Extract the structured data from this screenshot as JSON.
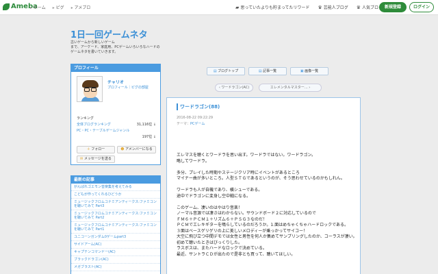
{
  "topbar": {
    "logo": "Ameba",
    "nav": [
      "ホーム",
      "ピグ",
      "アメブロ"
    ],
    "right_links": [
      {
        "icon": "bookmark-icon",
        "label": "思っていたよりも貯まってたリワード"
      },
      {
        "icon": "crown-icon",
        "label": "芸能人ブログ"
      },
      {
        "icon": "crown-icon",
        "label": "人気ブログ"
      }
    ],
    "new_register": "新規登録",
    "login": "ログイン"
  },
  "header": {
    "title": "1日一回ゲームネタ",
    "desc_lines": [
      "古いゲームから新しいゲーム",
      "まで、アーケード、家庭用、PCゲームいろいろなハードの",
      "ゲームネタを書いていきます。"
    ]
  },
  "profile": {
    "head": "プロフィール",
    "name": "チャリオ",
    "links": "プロフィール｜ピグの部屋",
    "ranking_label": "ランキング",
    "rank1_label": "全体ブログランキング",
    "rank1_value": "31,116位 ↓",
    "rank2_label": "PC・PC・テーブルゲームジャンル",
    "rank2_value": "197位 ↓",
    "follow": "フォロー",
    "ameba_friend": "アメンバーになる",
    "message": "メッセージを送る"
  },
  "recent": {
    "head": "最新の記事",
    "items": [
      "がんばれゴエモン音楽集を考えてみる",
      "こどもが作ってくれるひどうか",
      "ミュージックフロムコナミアンティークス:ファミコンを聴いてみて Part3",
      "ミュージックフロムコナミアンティークス:ファミコンを聴いてみて Part2",
      "ミュージックフロムコナミアンティークス:ファミコンを聴いてみて Part1",
      "ユニコーンガンダム0ゲームpart3",
      "サイドアーム(AC)",
      "キャプテンコマンドー(AC)",
      "ブラックドラゴン(AC)",
      "メガブラスト(AC)"
    ]
  },
  "toolbar": {
    "blog_top": "ブログトップ",
    "articles": "記事一覧",
    "images": "画像一覧"
  },
  "pager": {
    "prev": "ワードラゴン(AC)",
    "next": "エレメンタルマスター…"
  },
  "entry": {
    "title": "ワードラゴン(88)",
    "date": "2016-08-22 09:22:29",
    "theme_label": "テーマ：",
    "theme": "PCゲーム",
    "body": [
      "エレマスを聴くとワードラを思い出す。ワードラではない。ワードラゴン。",
      "略してワードラ。",
      "",
      "多分、プレイした時期やステージクリア時にイベントがあるところ",
      "マイナー曲が多いところ。人型ＳＴＧであるというのが、そう思わせているのかもしれん。",
      "",
      "ワードラも人が自機であり、横シューである。",
      "途中でドラゴンに変身し空中戦になる。",
      "",
      "このゲーム、凄いのはやはり音楽！",
      "ノーマル音源では凄さはわからない。サウンドボード２に対応しているので",
      "ＦＭ６＋ＰＣＭ１＋リズム６＋ＰＳＧ３なのだ！",
      "ＰＣＭでエレキギターを鳴らしているのだろうか。1.面はめちゃくちゃハードロックである。",
      "３面はベースゲリゲリの上に美しいメロディーが乗っかってサイコー！",
      "大空に飛び立つ中間デモでは女性と男性を何人か集めてサンプリングしたのか、コーラスが凄い。",
      "初めて聴いたときはびっくりした。",
      "ラスボスは、またハードなロックで決めている。",
      "最近、サントラＣＤが出たので是非とも買って、聴いてほしい。"
    ]
  }
}
